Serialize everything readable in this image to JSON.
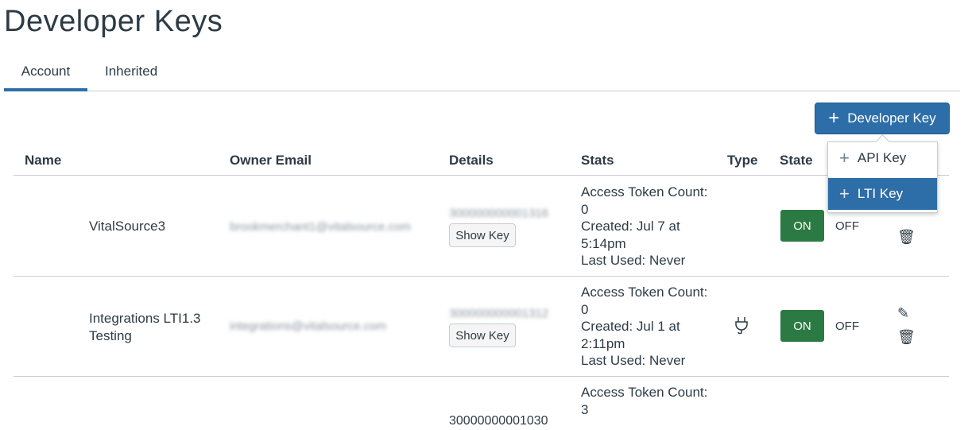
{
  "page": {
    "title": "Developer Keys"
  },
  "tabs": [
    {
      "label": "Account",
      "active": true
    },
    {
      "label": "Inherited",
      "active": false
    }
  ],
  "add_button": {
    "label": "Developer Key",
    "icon": "plus-icon"
  },
  "menu": {
    "items": [
      {
        "label": "API Key",
        "selected": false
      },
      {
        "label": "LTI Key",
        "selected": true
      }
    ]
  },
  "table": {
    "headers": [
      "Name",
      "Owner Email",
      "Details",
      "Stats",
      "Type",
      "State"
    ],
    "rows": [
      {
        "name": "VitalSource3",
        "email": "brookmerchant1@vitalsource.com",
        "key": "300000000001316",
        "show_key": "Show Key",
        "stats": [
          "Access Token Count:",
          "0",
          "Created: Jul 7 at",
          "5:14pm",
          "Last Used: Never"
        ],
        "type_icon": "",
        "on": "ON",
        "off": "OFF"
      },
      {
        "name": "Integrations LTI1.3 Testing",
        "email": "integrations@vitalsource.com",
        "key": "300000000001312",
        "show_key": "Show Key",
        "stats": [
          "Access Token Count:",
          "0",
          "Created: Jul 1 at",
          "2:11pm",
          "Last Used: Never"
        ],
        "type_icon": "plug-icon",
        "on": "ON",
        "off": "OFF"
      },
      {
        "key": "30000000001030",
        "stats": [
          "Access Token Count:",
          "3"
        ]
      }
    ]
  },
  "colors": {
    "primary": "#2d6ea8",
    "on": "#2c7a43"
  }
}
